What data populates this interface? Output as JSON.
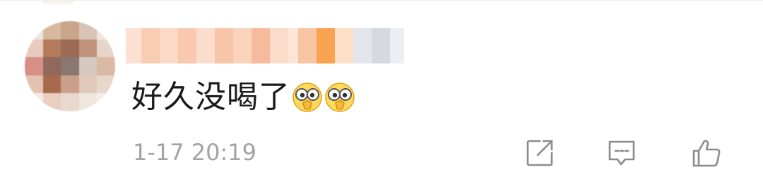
{
  "comment": {
    "text": "好久没喝了",
    "emojis": [
      "covering-eyes-emoji",
      "covering-eyes-emoji"
    ],
    "timestamp": "1-17 20:19"
  },
  "actions": [
    {
      "icon": "share-icon"
    },
    {
      "icon": "reply-comment-icon"
    },
    {
      "icon": "like-thumbs-up-icon"
    }
  ],
  "colors": {
    "text": "#1a1a1a",
    "muted": "#a3a3a3",
    "icon": "#8c8c8c",
    "emoji_fill": "#ffd95a",
    "divider": "#ededed"
  }
}
